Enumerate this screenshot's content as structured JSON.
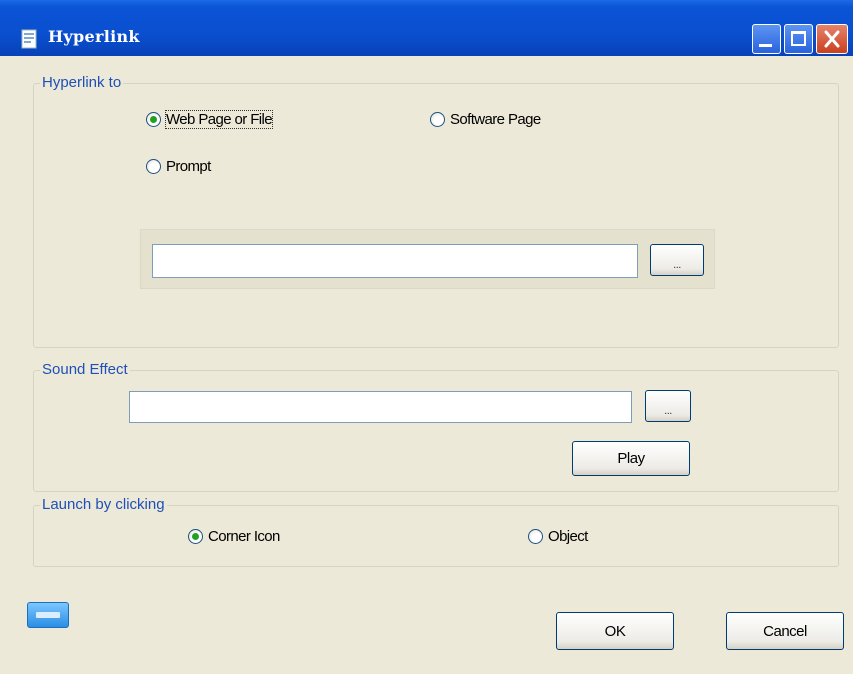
{
  "window": {
    "title": "Hyperlink",
    "icons": {
      "app": "document-icon",
      "minimize": "minimize-icon",
      "maximize": "maximize-icon",
      "close": "close-icon"
    },
    "colors": {
      "titlebar": "#0a4fd0",
      "close": "#c9401f",
      "legend": "#1f4fb8",
      "body": "#ece9d8"
    }
  },
  "hyperlink_group": {
    "legend": "Hyperlink to",
    "options": [
      {
        "label": "Web Page or File",
        "selected": true
      },
      {
        "label": "Software Page",
        "selected": false
      },
      {
        "label": "Prompt",
        "selected": false
      }
    ],
    "path_value": "",
    "browse_label": "..."
  },
  "sound_group": {
    "legend": "Sound Effect",
    "file_value": "",
    "browse_label": "...",
    "play_label": "Play"
  },
  "launch_group": {
    "legend": "Launch by clicking",
    "options": [
      {
        "label": "Corner Icon",
        "selected": true
      },
      {
        "label": "Object",
        "selected": false
      }
    ]
  },
  "footer": {
    "helper_icon": "keyboard-icon",
    "ok_label": "OK",
    "cancel_label": "Cancel"
  }
}
